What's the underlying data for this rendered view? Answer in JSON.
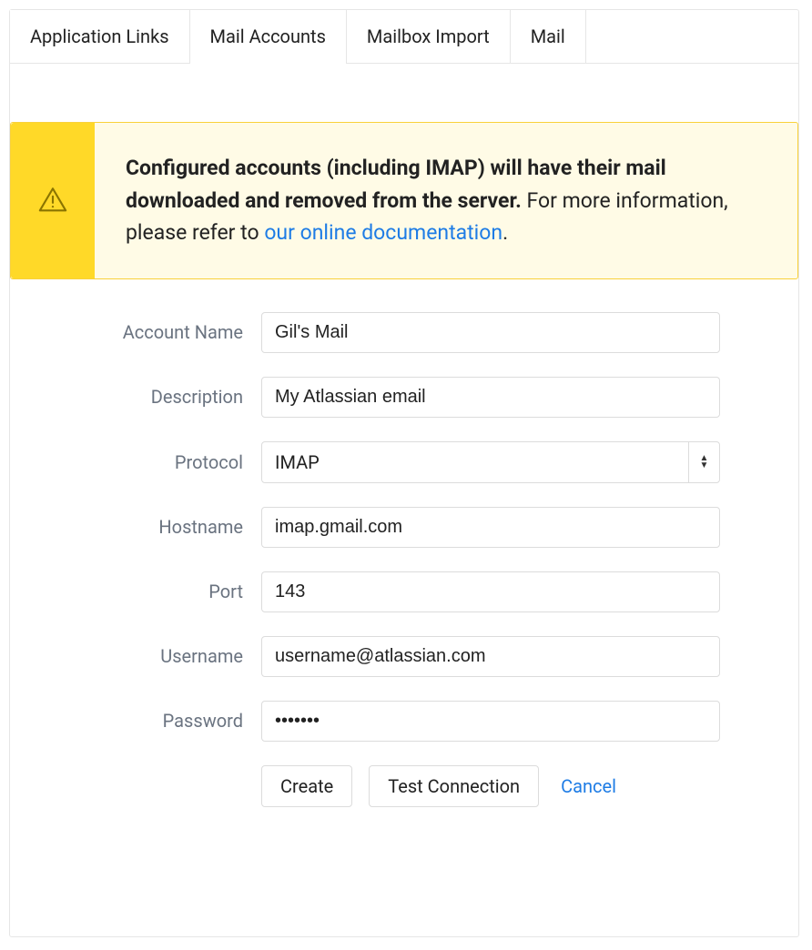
{
  "tabs": [
    {
      "label": "Application Links",
      "active": false
    },
    {
      "label": "Mail Accounts",
      "active": true
    },
    {
      "label": "Mailbox Import",
      "active": false
    },
    {
      "label": "Mail",
      "active": false
    }
  ],
  "alert": {
    "bold": "Configured accounts (including IMAP) will have their mail downloaded and removed from the server.",
    "rest": " For more information, please refer to ",
    "link": "our online documentation",
    "after_link": "."
  },
  "form": {
    "account_name": {
      "label": "Account Name",
      "value": "Gil's Mail"
    },
    "description": {
      "label": "Description",
      "value": "My Atlassian email"
    },
    "protocol": {
      "label": "Protocol",
      "value": "IMAP"
    },
    "hostname": {
      "label": "Hostname",
      "value": "imap.gmail.com"
    },
    "port": {
      "label": "Port",
      "value": "143"
    },
    "username": {
      "label": "Username",
      "value": "username@atlassian.com"
    },
    "password": {
      "label": "Password",
      "value": "•••••••"
    }
  },
  "actions": {
    "create": "Create",
    "test": "Test Connection",
    "cancel": "Cancel"
  }
}
